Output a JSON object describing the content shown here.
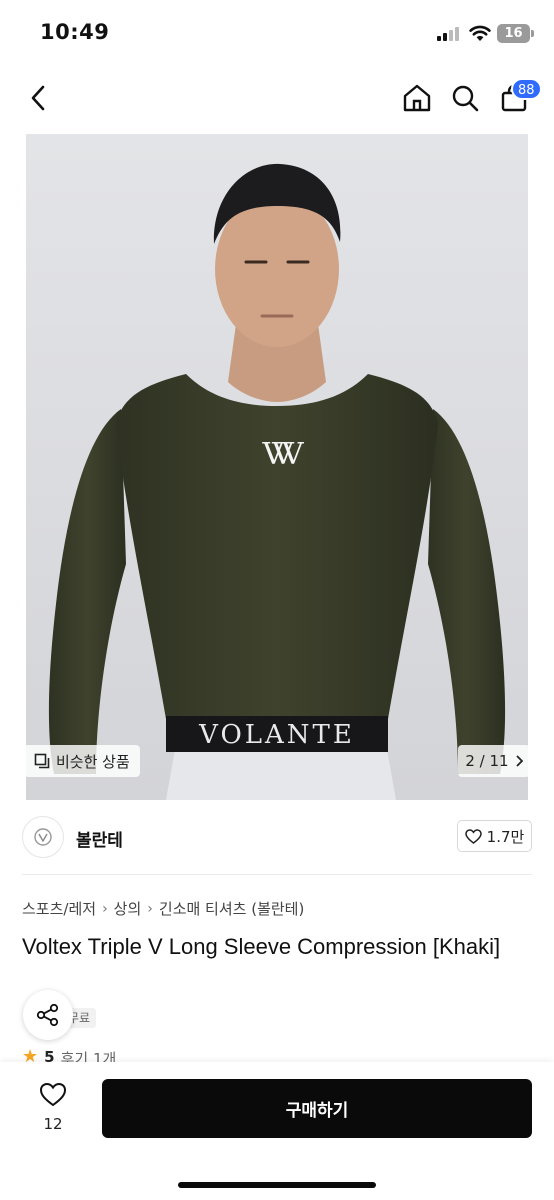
{
  "status_bar": {
    "time": "10:49",
    "battery": "16"
  },
  "nav": {
    "cart_count": "88",
    "icons": [
      "back-icon",
      "home-icon",
      "search-icon",
      "cart-icon"
    ]
  },
  "gallery": {
    "similar_label": "비슷한 상품",
    "page_indicator": "2 / 11",
    "shirt_logo": "VVV",
    "waistband_text": "VOLANTE"
  },
  "shop": {
    "name": "볼란테",
    "likes": "1.7만"
  },
  "breadcrumb": [
    "스포츠/레저",
    "상의",
    "긴소매 티셔츠 (볼란테)"
  ],
  "product": {
    "title": "Voltex Triple V Long Sleeve Compression [Khaki]",
    "tag": "무료배송",
    "rating": "5",
    "review_count": "후기 1개"
  },
  "bottom": {
    "wish_count": "12",
    "buy_label": "구매하기"
  },
  "colors": {
    "accent_badge": "#2f6bff",
    "buy_button": "#0a0a0a",
    "shirt": "#3a3d2a"
  }
}
